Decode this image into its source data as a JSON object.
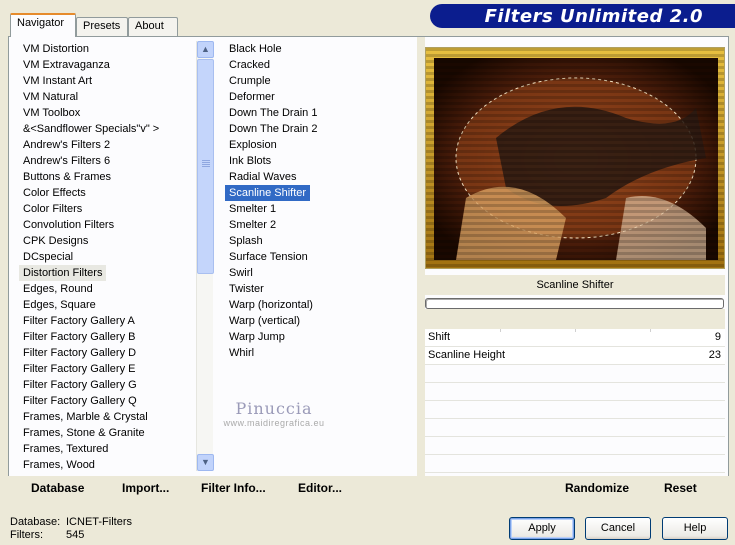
{
  "tabs": [
    {
      "label": "Navigator",
      "active": true
    },
    {
      "label": "Presets",
      "active": false
    },
    {
      "label": "About",
      "active": false
    }
  ],
  "app_title": "Filters Unlimited 2.0",
  "categories": {
    "items": [
      "VM Distortion",
      "VM Extravaganza",
      "VM Instant Art",
      "VM Natural",
      "VM Toolbox",
      "&<Sandflower Specials\"v\" >",
      "Andrew's Filters 2",
      "Andrew's Filters 6",
      "Buttons & Frames",
      "Color Effects",
      "Color Filters",
      "Convolution Filters",
      "CPK Designs",
      "DCspecial",
      "Distortion Filters",
      "Edges, Round",
      "Edges, Square",
      "Filter Factory Gallery A",
      "Filter Factory Gallery B",
      "Filter Factory Gallery D",
      "Filter Factory Gallery E",
      "Filter Factory Gallery G",
      "Filter Factory Gallery Q",
      "Frames, Marble & Crystal",
      "Frames, Stone & Granite",
      "Frames, Textured",
      "Frames, Wood"
    ],
    "selected_index": 14
  },
  "filters": {
    "items": [
      "Black Hole",
      "Cracked",
      "Crumple",
      "Deformer",
      "Down The Drain 1",
      "Down The Drain 2",
      "Explosion",
      "Ink Blots",
      "Radial Waves",
      "Scanline Shifter",
      "Smelter 1",
      "Smelter 2",
      "Splash",
      "Surface Tension",
      "Swirl",
      "Twister",
      "Warp (horizontal)",
      "Warp (vertical)",
      "Warp Jump",
      "Whirl"
    ],
    "selected_index": 9
  },
  "watermark": {
    "name": "Pinuccia",
    "url": "www.maidiregrafica.eu"
  },
  "preview": {
    "filter_name": "Scanline Shifter"
  },
  "params": [
    {
      "label": "Shift",
      "value": "9"
    },
    {
      "label": "Scanline Height",
      "value": "23"
    }
  ],
  "toolbar": {
    "database": "Database",
    "import": "Import...",
    "filter_info": "Filter Info...",
    "editor": "Editor...",
    "randomize": "Randomize",
    "reset": "Reset"
  },
  "status": {
    "database_label": "Database:",
    "database_value": "ICNET-Filters",
    "filters_label": "Filters:",
    "filters_value": "545"
  },
  "buttons": {
    "apply": "Apply",
    "cancel": "Cancel",
    "help": "Help"
  },
  "colors": {
    "banner": "#0b1d8e",
    "selection": "#316ac5",
    "tab_accent": "#e68b2c"
  }
}
